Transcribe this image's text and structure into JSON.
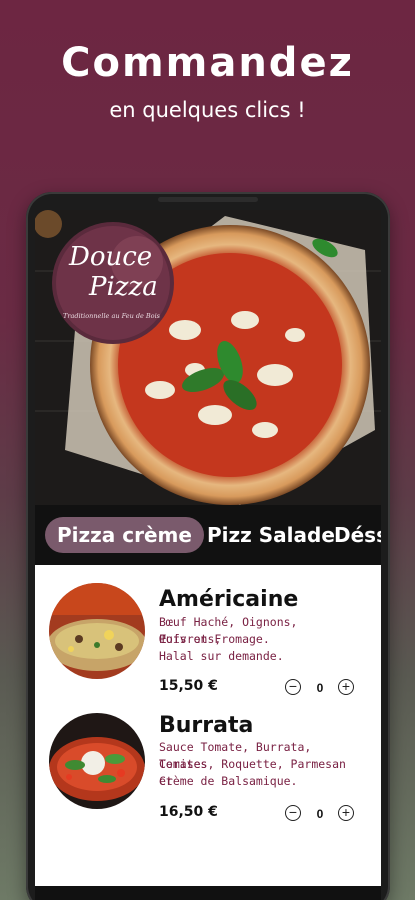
{
  "promo": {
    "headline": "Commandez",
    "subline": "en quelques clics !"
  },
  "hero": {
    "logo_line1": "Douce",
    "logo_line2": "Pizza",
    "logo_tagline": "Traditionnelle au Feu de Bois"
  },
  "tabs": [
    {
      "label": "Pizza crème",
      "active": true
    },
    {
      "label": "Pizz Salade",
      "active": false
    },
    {
      "label": "Déss",
      "active": false
    }
  ],
  "items": [
    {
      "name": "Américaine",
      "desc1": "Bœuf Haché, Oignons, Poivrons,",
      "desc2": "Œufs et Fromage.",
      "desc3": "Halal sur demande.",
      "price": "15,50 €",
      "quantity": "0"
    },
    {
      "name": "Burrata",
      "desc1": "Sauce Tomate, Burrata, Tomates",
      "desc2": "Cerises, Roquette, Parmesan et",
      "desc3": "Crème de Balsamique.",
      "price": "16,50 €",
      "quantity": "0"
    }
  ],
  "colors": {
    "brand": "#6d2642",
    "active_tab": "#7a5a6c",
    "description": "#7a2244"
  }
}
